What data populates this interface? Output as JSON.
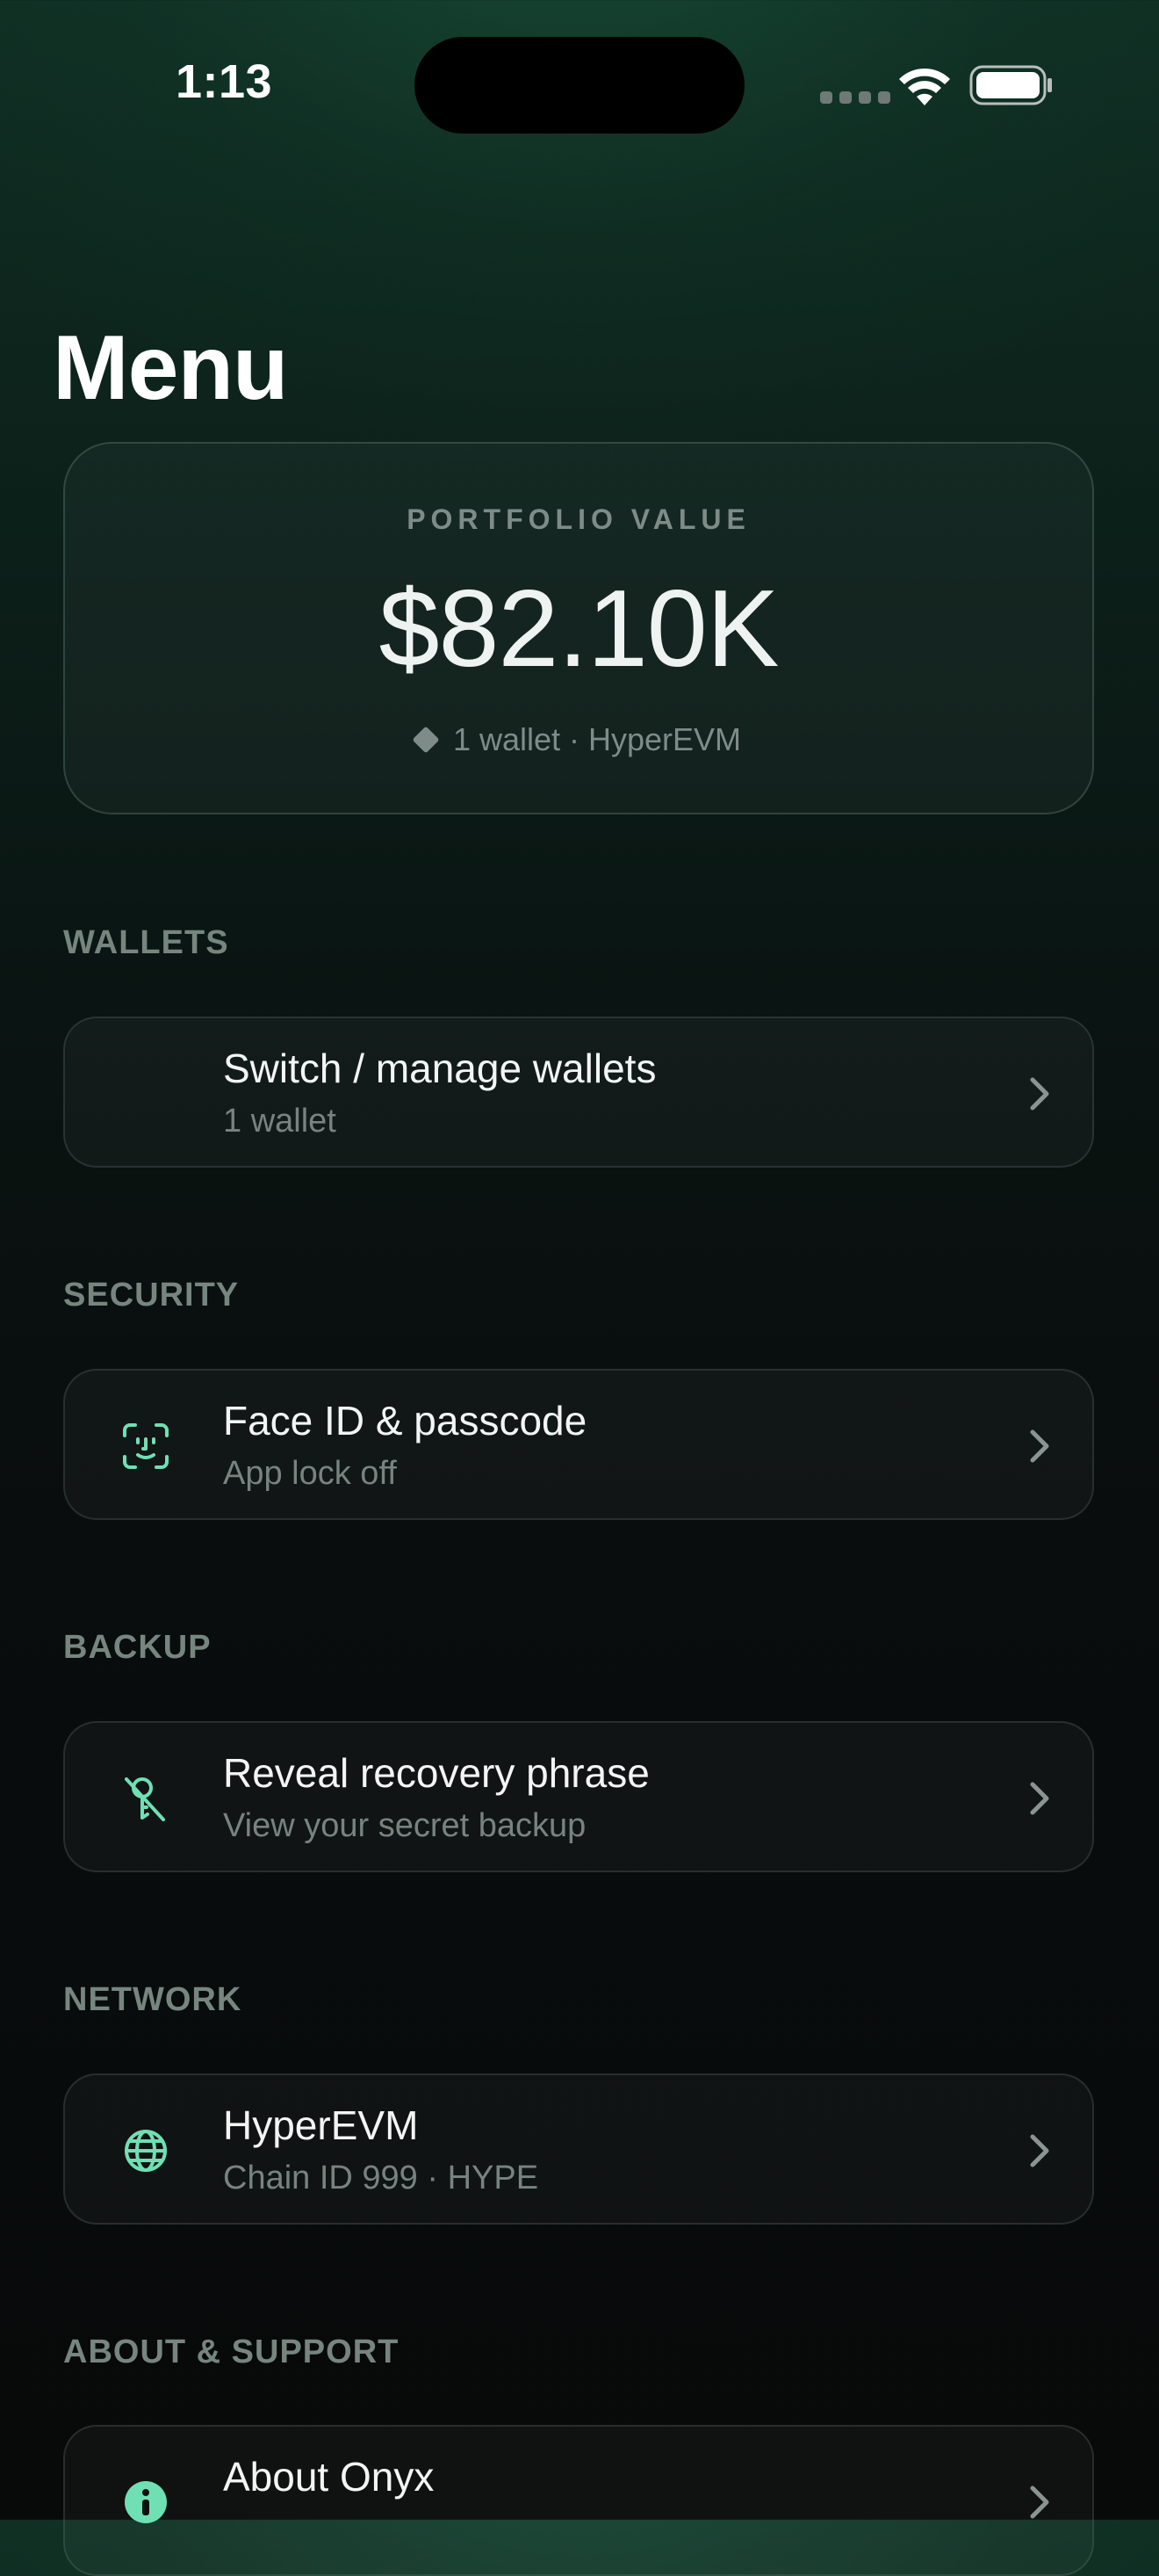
{
  "status_bar": {
    "time": "1:13"
  },
  "page": {
    "title": "Menu"
  },
  "portfolio": {
    "label": "PORTFOLIO VALUE",
    "value": "$82.10K",
    "subtitle": "1 wallet · HyperEVM",
    "icon": "diamond-icon"
  },
  "sections": {
    "wallets": {
      "header": "WALLETS",
      "row": {
        "title": "Switch / manage wallets",
        "subtitle": "1 wallet"
      }
    },
    "security": {
      "header": "SECURITY",
      "row": {
        "title": "Face ID & passcode",
        "subtitle": "App lock off",
        "icon": "face-id-icon"
      }
    },
    "backup": {
      "header": "BACKUP",
      "row": {
        "title": "Reveal recovery phrase",
        "subtitle": "View your secret backup",
        "icon": "key-slash-icon"
      }
    },
    "network": {
      "header": "NETWORK",
      "row": {
        "title": "HyperEVM",
        "subtitle": "Chain ID 999 · HYPE",
        "icon": "globe-icon"
      }
    },
    "about": {
      "header": "ABOUT & SUPPORT",
      "row": {
        "title": "About Onyx",
        "icon": "info-icon"
      }
    }
  },
  "colors": {
    "accent": "#6fe0b4",
    "background_top": "#0f2e23",
    "background_bottom": "#080a0a"
  }
}
